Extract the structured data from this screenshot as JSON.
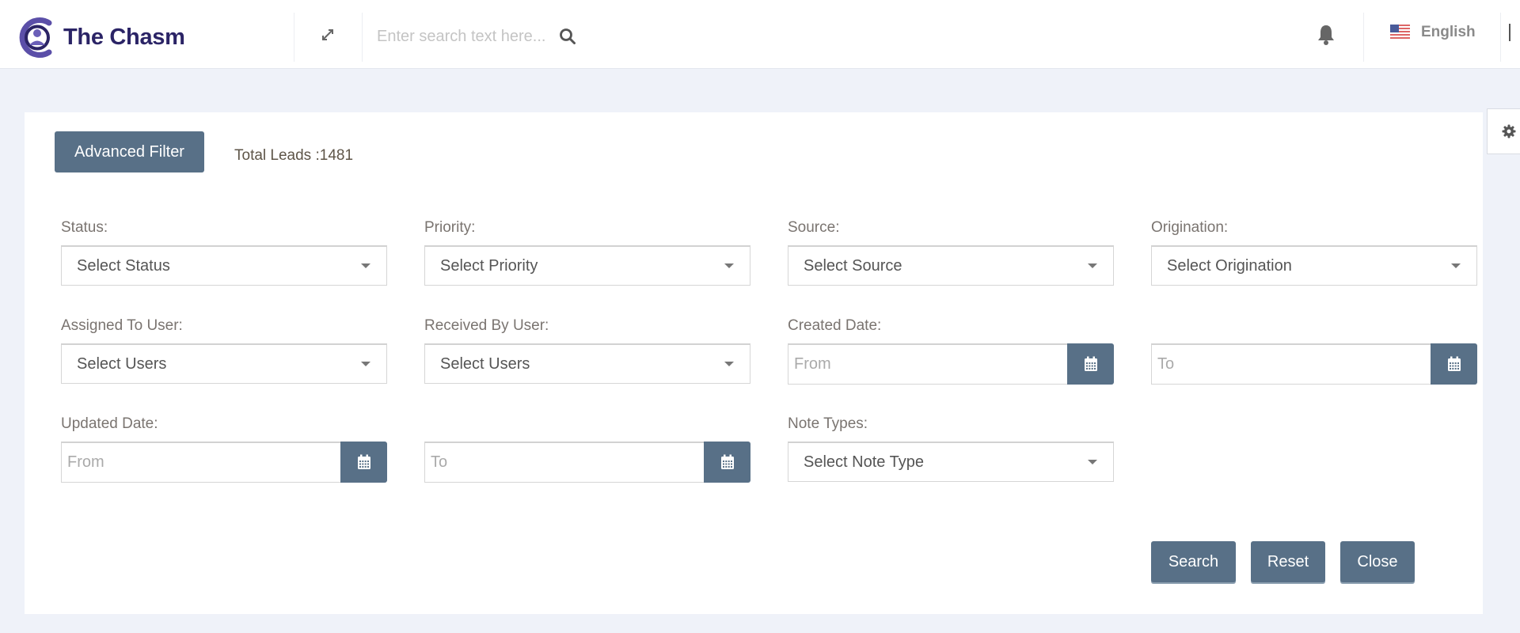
{
  "app": {
    "name": "The Chasm"
  },
  "topbar": {
    "search_placeholder": "Enter search text here...",
    "language": "English",
    "icons": [
      "expand-icon",
      "search-icon",
      "bell-icon",
      "us-flag-icon",
      "collapse-sidebar-icon"
    ]
  },
  "filter": {
    "advanced_filter_label": "Advanced Filter",
    "total_leads_label": "Total Leads :",
    "total_leads_value": "1481",
    "fields": {
      "status": {
        "label": "Status:",
        "value": "Select Status"
      },
      "priority": {
        "label": "Priority:",
        "value": "Select Priority"
      },
      "source": {
        "label": "Source:",
        "value": "Select Source"
      },
      "origination": {
        "label": "Origination:",
        "value": "Select Origination"
      },
      "assigned_to": {
        "label": "Assigned To User:",
        "value": "Select Users"
      },
      "received_by": {
        "label": "Received By User:",
        "value": "Select Users"
      },
      "created_date": {
        "label": "Created Date:",
        "from_placeholder": "From",
        "to_placeholder": "To"
      },
      "updated_date": {
        "label": "Updated Date:",
        "from_placeholder": "From",
        "to_placeholder": "To"
      },
      "note_types": {
        "label": "Note Types:",
        "value": "Select Note Type"
      }
    },
    "actions": {
      "search": "Search",
      "reset": "Reset",
      "close": "Close"
    }
  },
  "colors": {
    "primary_button": "#587087",
    "brand": "#2b2466",
    "logo_ring": "#5b4fa8",
    "background": "#eff2f9"
  }
}
